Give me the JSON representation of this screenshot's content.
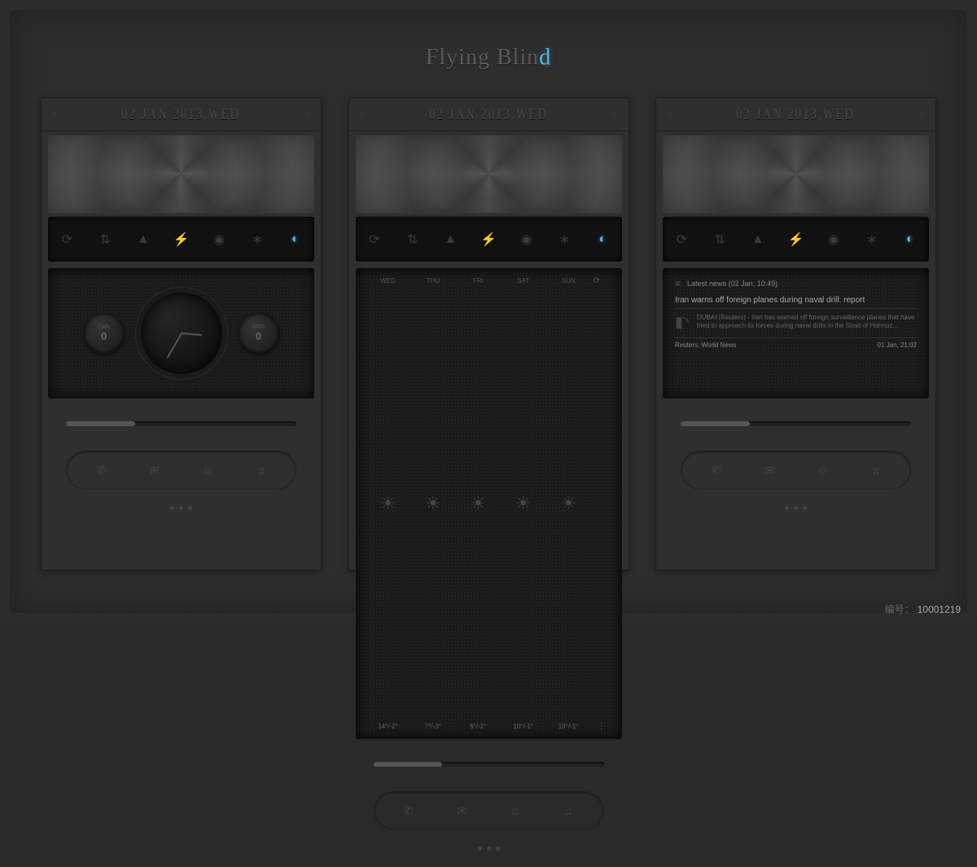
{
  "title": {
    "main": "Flying Blin",
    "accent": "d"
  },
  "date": "02 JAN 2013,WED",
  "toggles": [
    "sync",
    "data",
    "wifi",
    "charge",
    "gps",
    "bluetooth",
    "brightness"
  ],
  "clock": {
    "calls": {
      "label": "Calls",
      "value": "0"
    },
    "sms": {
      "label": "SMS",
      "value": "0"
    }
  },
  "forecast": {
    "days": [
      "WED",
      "THU",
      "FRI",
      "SAT",
      "SUN"
    ],
    "temps": [
      "14°/-2°",
      "7°/-3°",
      "6°/-2°",
      "10°/-1°",
      "13°/-1°"
    ]
  },
  "news": {
    "latest": "Latest news (02 Jan, 10:49)",
    "headline": "Iran warns off foreign planes during naval drill: report",
    "body": "DUBAI (Reuters) - Iran has warned off foreign surveillance planes that have tried to approach its forces during naval drills in the Strait of Hormuz...",
    "source": "Reuters: World News",
    "time": "01 Jan, 21:02"
  },
  "footer": {
    "label": "编号：",
    "value": "10001219"
  }
}
